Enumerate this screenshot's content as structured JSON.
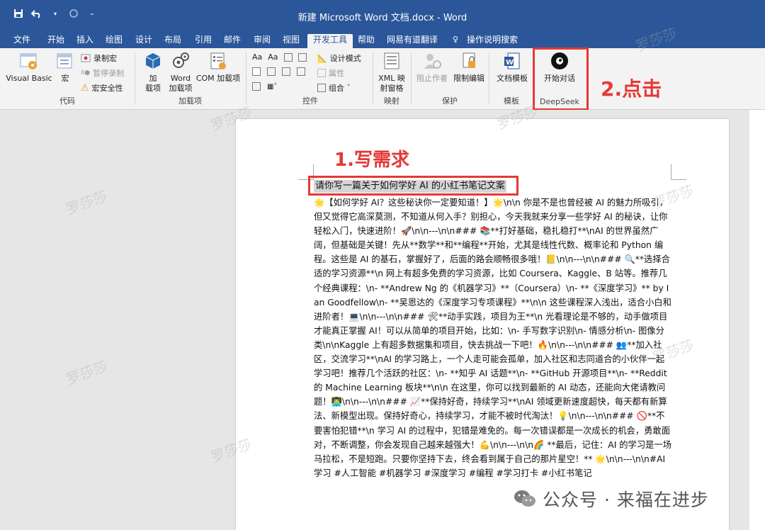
{
  "window": {
    "title": "新建 Microsoft Word 文档.docx - Word"
  },
  "qat": {
    "save_icon": "save-icon",
    "undo_icon": "undo-icon",
    "redo_icon": "redo-icon",
    "customize_icon": "customize-icon"
  },
  "menu": {
    "items": [
      "文件",
      "开始",
      "插入",
      "绘图",
      "设计",
      "布局",
      "引用",
      "邮件",
      "审阅",
      "视图",
      "开发工具",
      "帮助",
      "网易有道翻译",
      "操作说明搜索"
    ],
    "active": "开发工具"
  },
  "ribbon": {
    "code": {
      "name": "代码",
      "visual_basic": "Visual Basic",
      "macros": "宏",
      "record_macro": "录制宏",
      "pause_recording": "暂停录制",
      "macro_security": "宏安全性"
    },
    "addins": {
      "name": "加载项",
      "addins_line1": "加",
      "addins_line2": "载项",
      "word_addins_line1": "Word",
      "word_addins_line2": "加载项",
      "com_addins": "COM 加载项"
    },
    "controls": {
      "name": "控件",
      "design_mode": "设计模式",
      "properties": "属性",
      "group": "组合"
    },
    "mapping": {
      "name": "映射",
      "xml_line1": "XML 映",
      "xml_line2": "射窗格"
    },
    "protect": {
      "name": "保护",
      "block_authors": "阻止作者",
      "restrict_editing": "限制编辑"
    },
    "templates": {
      "name": "模板",
      "document_template": "文档模板"
    },
    "deepseek": {
      "name": "DeepSeek",
      "start_chat": "开始对话"
    }
  },
  "annotations": {
    "step1": "1.写需求",
    "step2": "2.点击"
  },
  "document": {
    "prompt": "请你写一篇关于如何学好 AI 的小红书笔记文案",
    "body": "🌟【如何学好 AI？这些秘诀你一定要知道！】🌟\\n\\n 你是不是也曾经被 AI 的魅力所吸引，但又觉得它高深莫测，不知道从何入手？别担心，今天我就来分享一些学好 AI 的秘诀，让你轻松入门，快速进阶！🚀\\n\\n---\\n\\n### 📚**打好基础，稳扎稳打**\\nAI 的世界虽然广阔，但基础是关键！先从**数学**和**编程**开始，尤其是线性代数、概率论和 Python 编程。这些是 AI 的基石，掌握好了，后面的路会顺畅很多哦！📒\\n\\n---\\n\\n### 🔍**选择合适的学习资源**\\n 网上有超多免费的学习资源，比如 Coursera、Kaggle、B 站等。推荐几个经典课程：\\n- **Andrew Ng 的《机器学习》**（Coursera）\\n- **《深度学习》** by Ian Goodfellow\\n- **吴恩达的《深度学习专项课程》**\\n\\n 这些课程深入浅出，适合小白和进阶者！💻\\n\\n---\\n\\n### 🛠**动手实践，项目为王**\\n 光看理论是不够的，动手做项目才能真正掌握 AI！可以从简单的项目开始，比如：\\n- 手写数字识别\\n- 情感分析\\n- 图像分类\\n\\nKaggle 上有超多数据集和项目，快去挑战一下吧！🔥\\n\\n---\\n\\n### 👥**加入社区，交流学习**\\nAI 的学习路上，一个人走可能会孤单，加入社区和志同道合的小伙伴一起学习吧！推荐几个活跃的社区：\\n- **知乎 AI 话题**\\n- **GitHub 开源项目**\\n- **Reddit 的 Machine Learning 板块**\\n\\n 在这里，你可以找到最新的 AI 动态，还能向大佬请教问题！👨‍💻\\n\\n---\\n\\n### 📈**保持好奇，持续学习**\\nAI 领域更新速度超快，每天都有新算法、新模型出现。保持好奇心，持续学习，才能不被时代淘汰！💡\\n\\n---\\n\\n### 🚫**不要害怕犯错**\\n 学习 AI 的过程中，犯错是难免的。每一次错误都是一次成长的机会，勇敢面对，不断调整，你会发现自己越来越强大！💪\\n\\n---\\n\\n🌈 **最后，记住：AI 的学习是一场马拉松，不是短跑。只要你坚持下去，终会看到属于自己的那片星空！** 🌟\\n\\n---\\n\\n#AI 学习 #人工智能 #机器学习 #深度学习 #编程 #学习打卡 #小红书笔记"
  },
  "watermark": "罗莎莎",
  "brand": {
    "icon": "wechat-icon",
    "text": "公众号 · 来福在进步"
  }
}
